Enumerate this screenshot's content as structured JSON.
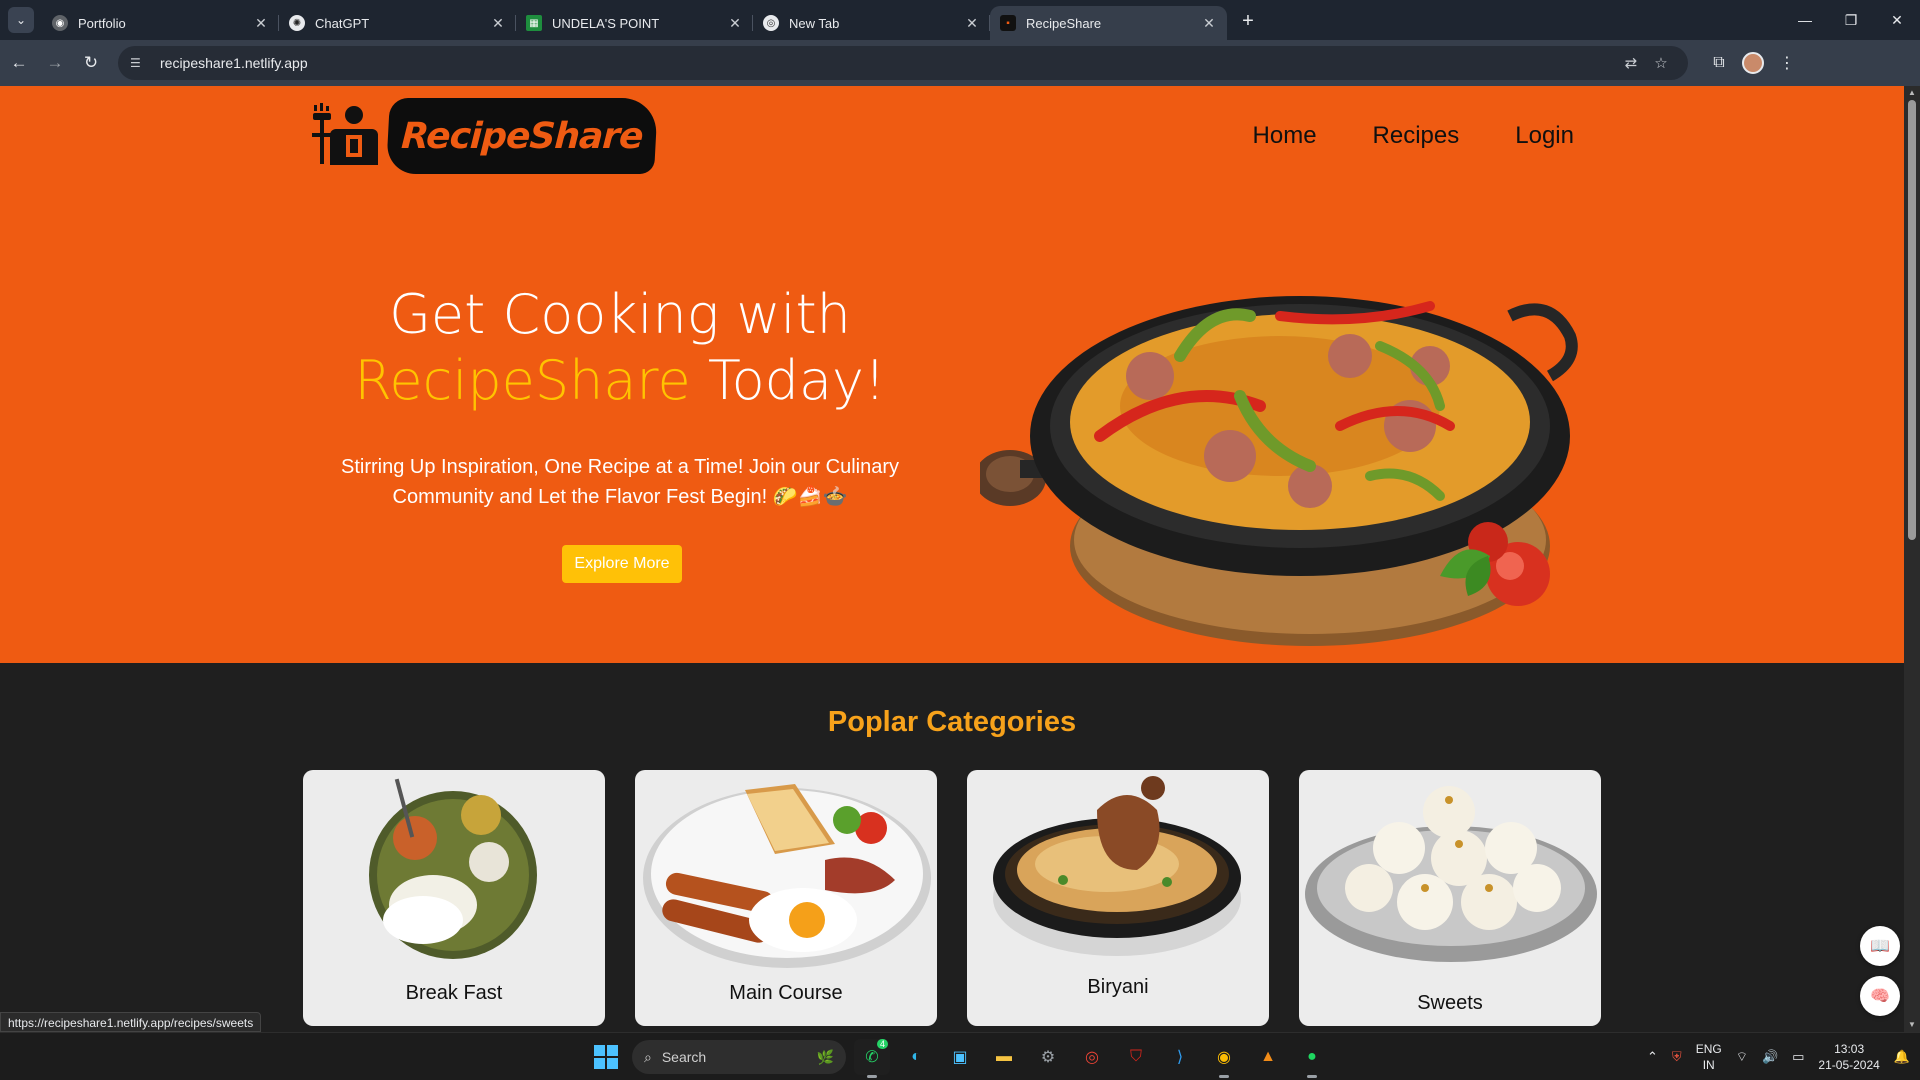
{
  "browser": {
    "tabs": [
      {
        "label": "Portfolio",
        "icon": "portfolio-favicon",
        "active": false
      },
      {
        "label": "ChatGPT",
        "icon": "chatgpt-favicon",
        "active": false
      },
      {
        "label": "UNDELA'S POINT",
        "icon": "sheets-favicon",
        "active": false
      },
      {
        "label": "New Tab",
        "icon": "chrome-favicon",
        "active": false
      },
      {
        "label": "RecipeShare",
        "icon": "recipeshare-favicon",
        "active": true
      }
    ],
    "url": "recipeshare1.netlify.app",
    "status_url": "https://recipeshare1.netlify.app/recipes/sweets"
  },
  "site": {
    "logo_text": "RecipeShare",
    "nav": [
      "Home",
      "Recipes",
      "Login"
    ],
    "hero": {
      "title_line1": "Get Cooking with",
      "title_highlight": "RecipeShare",
      "title_end": " Today!",
      "subtitle": "Stirring Up Inspiration, One Recipe at a Time! Join our Culinary Community and Let the Flavor Fest Begin! 🌮🍰🍲",
      "button": "Explore More"
    },
    "categories_title": "Poplar Categories",
    "categories": [
      "Break Fast",
      "Main Course",
      "Biryani",
      "Sweets"
    ]
  },
  "taskbar": {
    "search_placeholder": "Search",
    "lang_line1": "ENG",
    "lang_line2": "IN",
    "time": "13:03",
    "date": "21-05-2024",
    "whatsapp_badge": "4"
  },
  "colors": {
    "hero_bg": "#ef5b12",
    "accent_yellow": "#ffc400",
    "category_title": "#f7a21b",
    "button_bg": "#ffc107"
  }
}
